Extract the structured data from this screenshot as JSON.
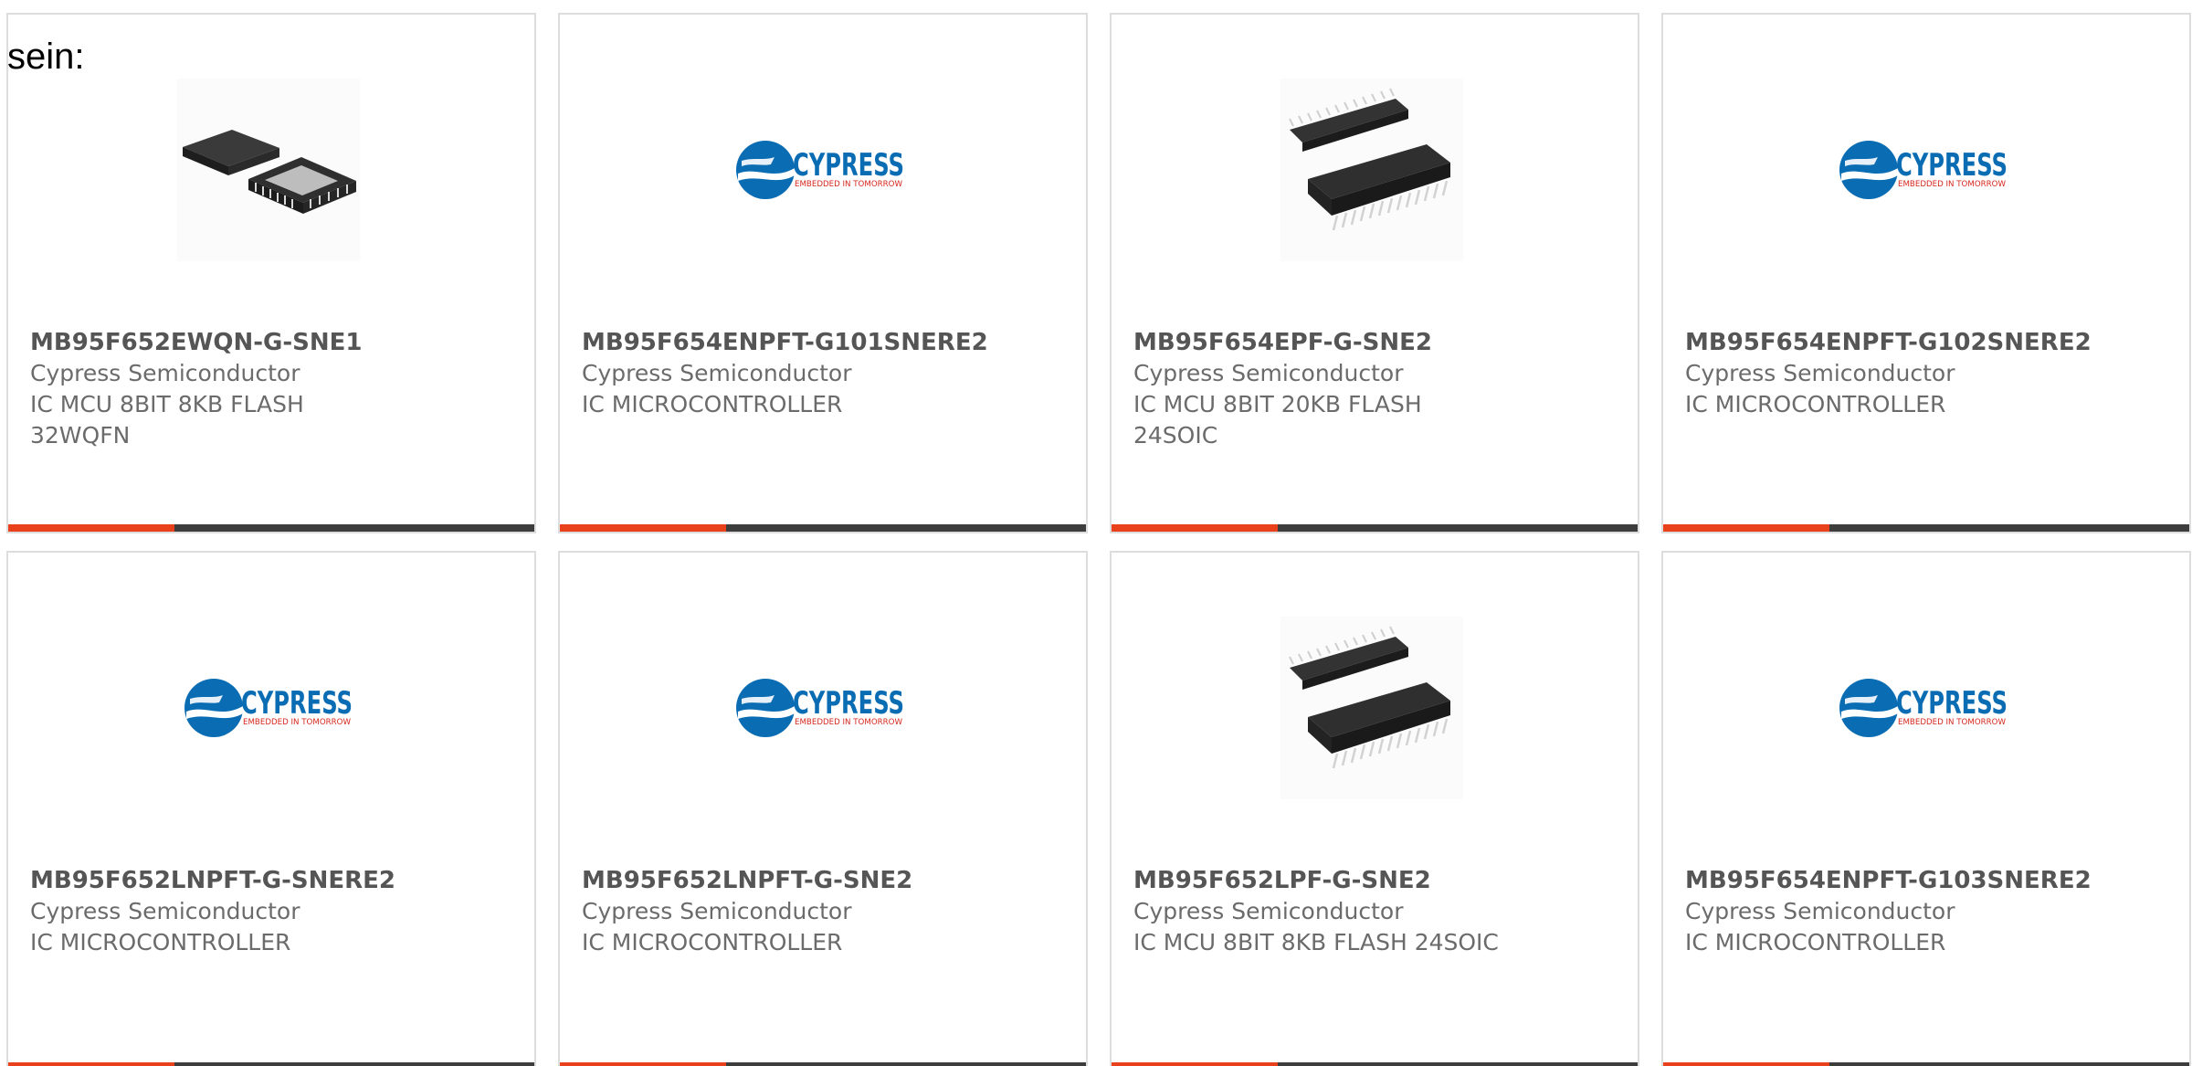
{
  "intro": "sein:",
  "colors": {
    "accent": "#e8411c",
    "bar": "#3d3d3d",
    "cypress_blue": "#0a6cb3",
    "cypress_red": "#d6281e"
  },
  "products": [
    {
      "part": "MB95F652EWQN-G-SNE1",
      "manufacturer": "Cypress Semiconductor",
      "description": "IC MCU 8BIT 8KB FLASH 32WQFN",
      "image": "qfn-chip"
    },
    {
      "part": "MB95F654ENPFT-G101SNERE2",
      "manufacturer": "Cypress Semiconductor",
      "description": "IC MICROCONTROLLER",
      "image": "cypress-logo"
    },
    {
      "part": "MB95F654EPF-G-SNE2",
      "manufacturer": "Cypress Semiconductor",
      "description": "IC MCU 8BIT 20KB FLASH 24SOIC",
      "image": "soic-chip"
    },
    {
      "part": "MB95F654ENPFT-G102SNERE2",
      "manufacturer": "Cypress Semiconductor",
      "description": "IC MICROCONTROLLER",
      "image": "cypress-logo"
    },
    {
      "part": "MB95F652LNPFT-G-SNERE2",
      "manufacturer": "Cypress Semiconductor",
      "description": "IC MICROCONTROLLER",
      "image": "cypress-logo"
    },
    {
      "part": "MB95F652LNPFT-G-SNE2",
      "manufacturer": "Cypress Semiconductor",
      "description": "IC MICROCONTROLLER",
      "image": "cypress-logo"
    },
    {
      "part": "MB95F652LPF-G-SNE2",
      "manufacturer": "Cypress Semiconductor",
      "description": "IC MCU 8BIT 8KB FLASH 24SOIC",
      "image": "soic-chip"
    },
    {
      "part": "MB95F654ENPFT-G103SNERE2",
      "manufacturer": "Cypress Semiconductor",
      "description": "IC MICROCONTROLLER",
      "image": "cypress-logo"
    }
  ],
  "logo": {
    "word": "CYPRESS",
    "tagline": "EMBEDDED IN TOMORROW"
  }
}
